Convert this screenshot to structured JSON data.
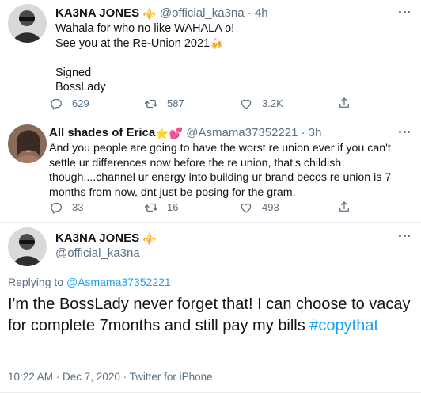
{
  "tweets": [
    {
      "name": "KA3NA JONES",
      "badge_emoji": "⚜️",
      "handle": "@official_ka3na",
      "separator": "·",
      "time": "4h",
      "text_lines": [
        "Wahala for who no like WAHALA o!",
        "See you at the Re-Union 2021"
      ],
      "line2_emoji": "🍻",
      "text_lines_2": [
        "Signed",
        "BossLady"
      ],
      "reply_count": "629",
      "retweet_count": "587",
      "like_count": "3.2K"
    },
    {
      "name": "All shades of Erica",
      "name_emojis": "⭐💕",
      "handle": "@Asmama37352221",
      "separator": "·",
      "time": "3h",
      "text": "And you people are going to have the worst re union ever if you can't settle ur differences now before the re union, that's childish though....channel ur energy into building ur brand becos re union is 7 months from now, dnt just be posing for the gram.",
      "reply_count": "33",
      "retweet_count": "16",
      "like_count": "493"
    }
  ],
  "main_tweet": {
    "name": "KA3NA JONES",
    "badge_emoji": "⚜️",
    "handle": "@official_ka3na",
    "replying_label": "Replying to",
    "replying_to": "@Asmama37352221",
    "text": "I'm the BossLady never forget that! I can choose to vacay for complete 7months and still pay my bills",
    "hashtag": "#copythat",
    "timestamp": "10:22 AM · Dec 7, 2020 · Twitter for iPhone"
  },
  "icons": [
    "reply-icon",
    "retweet-icon",
    "like-icon",
    "share-icon",
    "more-icon"
  ],
  "colors": {
    "text": "#0f1419",
    "secondary": "#5b7083",
    "link": "#1da1f2",
    "divider": "#ebeef0"
  }
}
